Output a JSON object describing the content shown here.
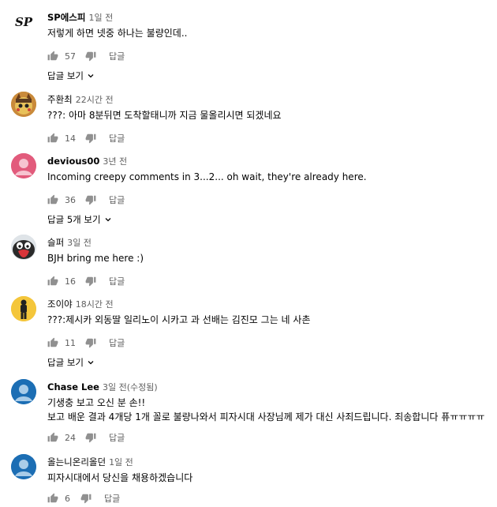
{
  "comments": [
    {
      "author": "SP에스피",
      "time": "1일 전",
      "lines": [
        "저렇게 하면 넷중 하나는 불량인데.."
      ],
      "likes": "57",
      "reply": "답글",
      "view_replies": "답글 보기",
      "avatar": "SP"
    },
    {
      "author": "주환최",
      "time": "22시간 전",
      "lines": [
        "???: 아마 8분뒤면 도착할태니까 지금 물올리시면 되겠네요"
      ],
      "likes": "14",
      "reply": "답글",
      "view_replies": ""
    },
    {
      "author": "devious00",
      "time": "3년 전",
      "lines": [
        "Incoming creepy comments in 3...2... oh wait, they're already here."
      ],
      "likes": "36",
      "reply": "답글",
      "view_replies": "답글 5개 보기"
    },
    {
      "author": "슬퍼",
      "time": "3일 전",
      "lines": [
        "BJH bring me here :)"
      ],
      "likes": "16",
      "reply": "답글",
      "view_replies": ""
    },
    {
      "author": "조이야",
      "time": "18시간 전",
      "lines": [
        "???:제시카 외동딸 일리노이 시카고 과 선배는 김진모 그는 네 사촌"
      ],
      "likes": "11",
      "reply": "답글",
      "view_replies": "답글 보기"
    },
    {
      "author": "Chase Lee",
      "time": "3일 전(수정됨)",
      "lines": [
        "기생충 보고 오신 분 손!!",
        "보고 배운 결과 4개당 1개 꼴로 불량나와서 피자시대 사장님께 제가 대신 사죄드립니다. 죄송합니다 퓨ㅠㅠㅠㅠ"
      ],
      "likes": "24",
      "reply": "답글",
      "view_replies": ""
    },
    {
      "author": "올는니온리올던",
      "time": "1일 전",
      "lines": [
        "피자시대에서 당신을 채용하겠습니다"
      ],
      "likes": "6",
      "reply": "답글",
      "view_replies": ""
    }
  ]
}
